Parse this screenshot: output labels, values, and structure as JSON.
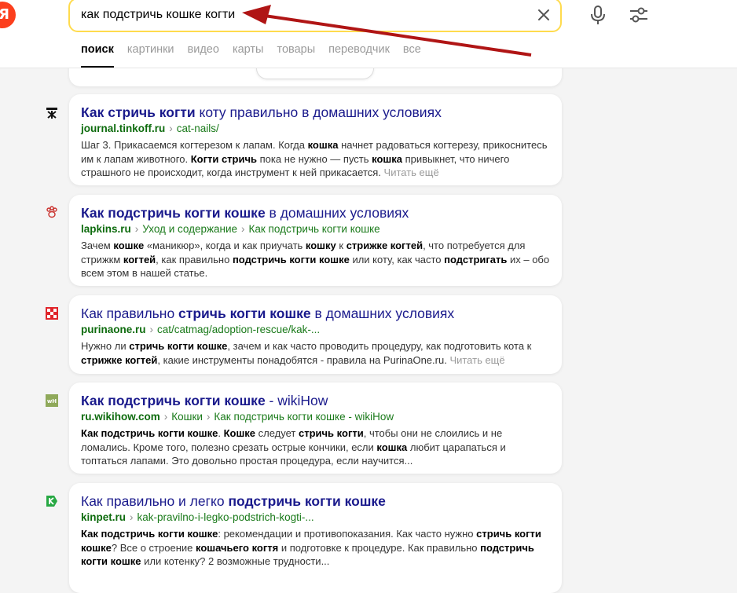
{
  "logo": {
    "letter": "Я"
  },
  "search": {
    "query": "как подстричь кошке когти"
  },
  "tabs": [
    {
      "label": "поиск"
    },
    {
      "label": "картинки"
    },
    {
      "label": "видео"
    },
    {
      "label": "карты"
    },
    {
      "label": "товары"
    },
    {
      "label": "переводчик"
    },
    {
      "label": "все"
    }
  ],
  "results": [
    {
      "title": [
        {
          "t": "Как стричь когти",
          "b": true
        },
        {
          "t": " коту правильно в домашних условиях",
          "b": false
        }
      ],
      "domain": "journal.tinkoff.ru",
      "path": [
        "cat-nails/"
      ],
      "snippet": [
        {
          "t": "Шаг 3. Прикасаемся когтерезом к лапам. Когда ",
          "b": false
        },
        {
          "t": "кошка",
          "b": true
        },
        {
          "t": " начнет радоваться когтерезу, прикоснитесь им к лапам животного. ",
          "b": false
        },
        {
          "t": "Когти стричь",
          "b": true
        },
        {
          "t": " пока не нужно — пусть ",
          "b": false
        },
        {
          "t": "кошка",
          "b": true
        },
        {
          "t": " привыкнет, что ничего страшного не происходит, когда инструмент к ней прикасается. ",
          "b": false
        }
      ],
      "more": "Читать ещё",
      "favicon": "tinkoff-icon"
    },
    {
      "title": [
        {
          "t": "Как подстричь когти кошке",
          "b": true
        },
        {
          "t": " в домашних условиях",
          "b": false
        }
      ],
      "domain": "lapkins.ru",
      "path": [
        "Уход и содержание",
        "Как подстричь когти кошке"
      ],
      "snippet": [
        {
          "t": "Зачем ",
          "b": false
        },
        {
          "t": "кошке",
          "b": true
        },
        {
          "t": " «маникюр», когда и как приучать ",
          "b": false
        },
        {
          "t": "кошку",
          "b": true
        },
        {
          "t": " к ",
          "b": false
        },
        {
          "t": "стрижке когтей",
          "b": true
        },
        {
          "t": ", что потребуется для стрижкм ",
          "b": false
        },
        {
          "t": "когтей",
          "b": true
        },
        {
          "t": ", как правильно ",
          "b": false
        },
        {
          "t": "подстричь когти кошке",
          "b": true
        },
        {
          "t": " или коту, как часто ",
          "b": false
        },
        {
          "t": "подстригать",
          "b": true
        },
        {
          "t": " их – обо всем этом в нашей статье.",
          "b": false
        }
      ],
      "more": "",
      "favicon": "paw-icon"
    },
    {
      "title": [
        {
          "t": "Как правильно ",
          "b": false
        },
        {
          "t": "стричь когти кошке",
          "b": true
        },
        {
          "t": " в домашних условиях",
          "b": false
        }
      ],
      "domain": "purinaone.ru",
      "path": [
        "cat/catmag/adoption-rescue/kak-..."
      ],
      "snippet": [
        {
          "t": "Нужно ли ",
          "b": false
        },
        {
          "t": "стричь когти кошке",
          "b": true
        },
        {
          "t": ", зачем и как часто проводить процедуру, как подготовить кота к ",
          "b": false
        },
        {
          "t": "стрижке когтей",
          "b": true
        },
        {
          "t": ", какие инструменты понадобятся - правила на PurinaOne.ru. ",
          "b": false
        }
      ],
      "more": "Читать ещё",
      "favicon": "purina-icon"
    },
    {
      "title": [
        {
          "t": "Как подстричь когти кошке",
          "b": true
        },
        {
          "t": " - wikiHow",
          "b": false
        }
      ],
      "domain": "ru.wikihow.com",
      "path": [
        "Кошки",
        "Как подстричь когти кошке - wikiHow"
      ],
      "snippet": [
        {
          "t": "Как подстричь когти кошке",
          "b": true
        },
        {
          "t": ". ",
          "b": false
        },
        {
          "t": "Кошке",
          "b": true
        },
        {
          "t": " следует ",
          "b": false
        },
        {
          "t": "стричь когти",
          "b": true
        },
        {
          "t": ", чтобы они не слоились и не ломались. Кроме того, полезно срезать острые кончики, если ",
          "b": false
        },
        {
          "t": "кошка",
          "b": true
        },
        {
          "t": " любит царапаться и топтаться лапами. Это довольно простая процедура, если научится...",
          "b": false
        }
      ],
      "more": "",
      "favicon": "wikihow-icon"
    },
    {
      "title": [
        {
          "t": "Как правильно и легко ",
          "b": false
        },
        {
          "t": "подстричь когти кошке",
          "b": true
        }
      ],
      "domain": "kinpet.ru",
      "path": [
        "kak-pravilno-i-legko-podstrich-kogti-..."
      ],
      "snippet": [
        {
          "t": "Как подстричь когти кошке",
          "b": true
        },
        {
          "t": ": рекомендации и противопоказания. Как часто нужно ",
          "b": false
        },
        {
          "t": "стричь когти кошке",
          "b": true
        },
        {
          "t": "? Все о строение ",
          "b": false
        },
        {
          "t": "кошачьего когтя",
          "b": true
        },
        {
          "t": " и подготовке к процедуре. Как правильно ",
          "b": false
        },
        {
          "t": "подстричь когти кошке",
          "b": true
        },
        {
          "t": " или котенку? 2 возможные трудности...",
          "b": false
        }
      ],
      "more": "",
      "favicon": "kinpet-icon"
    }
  ],
  "colors": {
    "accent_border": "#ffdb4d",
    "title": "#1a1a8c",
    "url": "#0d6b0d",
    "arrow": "#b01515"
  }
}
